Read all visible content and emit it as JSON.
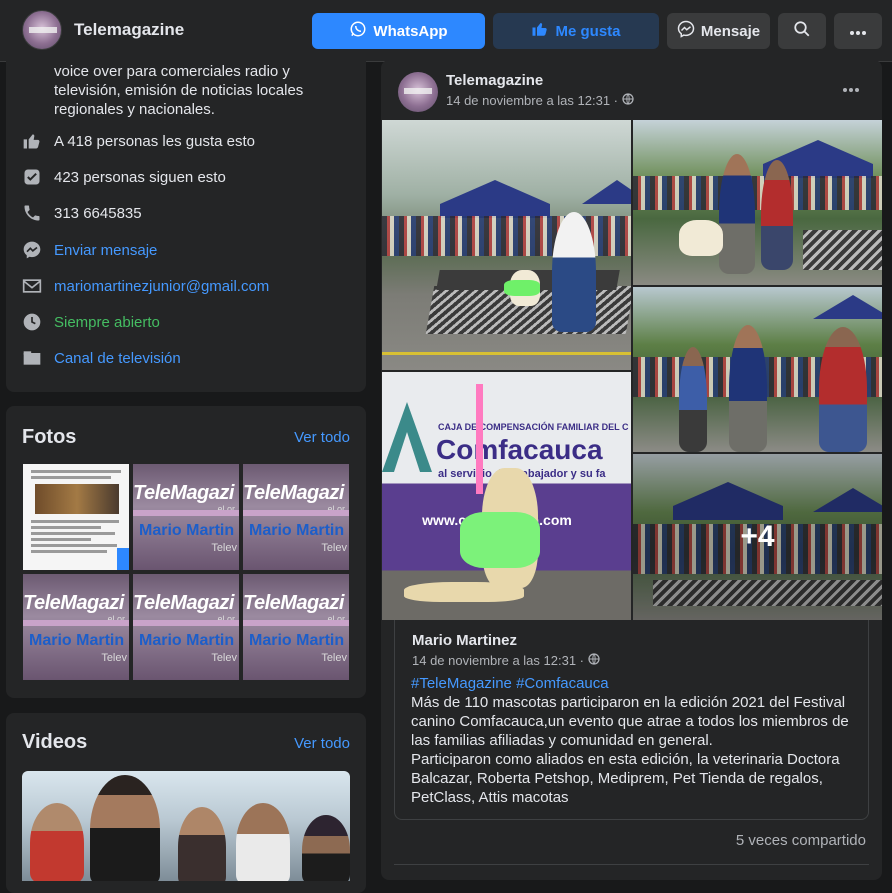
{
  "header": {
    "page_name": "Telemagazine",
    "whatsapp_label": "WhatsApp",
    "like_label": "Me gusta",
    "message_label": "Mensaje"
  },
  "about": {
    "description": "voice over para comerciales radio y televisión, emisión de noticias locales regionales y nacionales.",
    "likes": "A 418 personas les gusta esto",
    "followers": "423 personas siguen esto",
    "phone": "313 6645835",
    "send_message": "Enviar mensaje",
    "email": "mariomartinezjunior@gmail.com",
    "hours": "Siempre abierto",
    "category": "Canal de televisión"
  },
  "photos": {
    "title": "Fotos",
    "see_all": "Ver todo",
    "thumb_title": "TeleMagazi",
    "thumb_sub": "Mario Martin",
    "thumb_tv": "Telev",
    "thumb_small": "el or"
  },
  "videos": {
    "title": "Videos",
    "see_all": "Ver todo"
  },
  "post": {
    "author": "Telemagazine",
    "time": "14 de noviembre a las 12:31 ·",
    "more_photos": "+4",
    "banner_title": "CAJA DE COMPENSACIÓN FAMILIAR DEL C",
    "banner_brand": "Comfacauca",
    "banner_tagline": "al servicio del trabajador y su fa",
    "banner_url": "www.comfacauca.com",
    "original": {
      "author": "Mario Martinez",
      "time": "14 de noviembre a las 12:31 ·",
      "hashtags": "#TeleMagazine #Comfacauca",
      "paragraph1": " Más de 110 mascotas participaron en la edición 2021 del Festival canino Comfacauca,un evento que atrae a todos los miembros de las familias afiliadas y comunidad en general.",
      "paragraph2": "Participaron como aliados en esta edición, la veterinaria Doctora Balcazar, Roberta Petshop, Mediprem, Pet Tienda de regalos, PetClass, Attis macotas"
    },
    "shares": "5 veces compartido"
  },
  "colors": {
    "accent": "#2d88ff",
    "link": "#4599ff",
    "open_green": "#45bd62",
    "card_bg": "#242526",
    "page_bg": "#18191a"
  },
  "icons": [
    "whatsapp-icon",
    "thumbs-up-icon",
    "messenger-icon",
    "search-icon",
    "more-icon",
    "like-icon",
    "follow-check-icon",
    "phone-icon",
    "envelope-icon",
    "clock-icon",
    "tag-icon",
    "globe-icon"
  ]
}
